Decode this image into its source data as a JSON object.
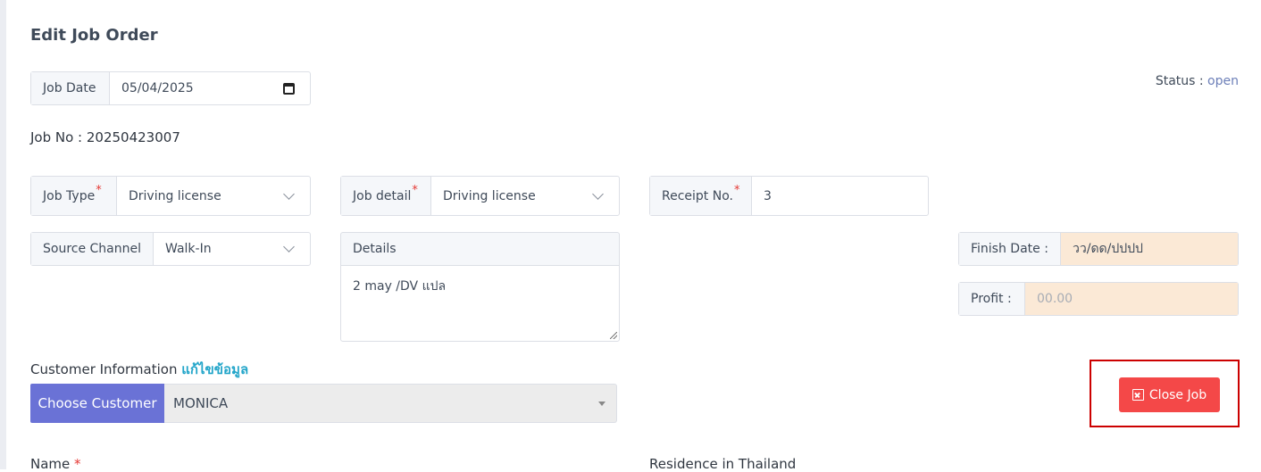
{
  "page": {
    "title": "Edit Job Order"
  },
  "job_date": {
    "label": "Job Date",
    "value": "05/04/2025"
  },
  "status": {
    "label": "Status :",
    "value": "open"
  },
  "job_no": {
    "text": "Job No : 20250423007"
  },
  "job_type": {
    "label": "Job Type",
    "required": "*",
    "value": "Driving license"
  },
  "job_detail": {
    "label": "Job detail",
    "required": "*",
    "value": "Driving license"
  },
  "receipt_no": {
    "label": "Receipt No.",
    "required": "*",
    "value": "3"
  },
  "source_channel": {
    "label": "Source Channel",
    "value": "Walk-In"
  },
  "details": {
    "label": "Details",
    "value": "2 may /DV แปล"
  },
  "finish_date": {
    "label": "Finish Date :",
    "placeholder": "วว/ดด/ปปปป"
  },
  "profit": {
    "label": "Profit :",
    "placeholder": "00.00"
  },
  "customer": {
    "label": "Customer Information",
    "edit_link": "แก้ไขข้อมูล",
    "choose_button": "Choose Customer",
    "selected": "MONICA"
  },
  "close_job": {
    "label": "Close Job"
  },
  "bottom": {
    "name_label": "Name",
    "name_required": "*",
    "residence_label": "Residence in Thailand"
  },
  "colors": {
    "primary": "#6a72d6",
    "danger": "#f44848",
    "highlight": "#cc0000",
    "peach": "#fbe9d6",
    "link": "#22a5c9"
  },
  "icons": {
    "calendar": "calendar-icon",
    "chevron": "chevron-down-icon",
    "close": "close-square-icon"
  }
}
